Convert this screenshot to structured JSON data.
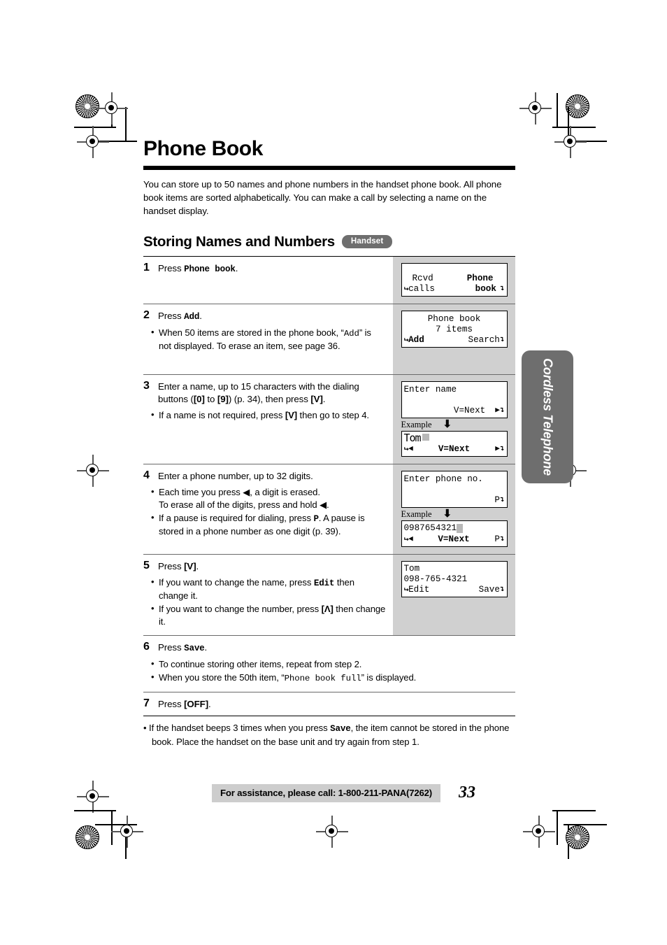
{
  "document": {
    "chapter_title": "Phone Book",
    "intro": "You can store up to 50 names and phone numbers in the handset phone book. All phone book items are sorted alphabetically. You can make a call by selecting a name on the handset display.",
    "section_title": "Storing Names and Numbers",
    "section_badge": "Handset",
    "side_tab": "Cordless Telephone",
    "page_number": "33",
    "footer_text": "For assistance, please call: 1-800-211-PANA(7262)",
    "example_label": "Example"
  },
  "steps": [
    {
      "num": "1",
      "text_pre": "Press ",
      "text_mono": "Phone book",
      "text_post": ".",
      "bullets": []
    },
    {
      "num": "2",
      "text_pre": "Press ",
      "text_mono": "Add",
      "text_post": ".",
      "bullets": [
        "When 50 items are stored in the phone book, “Add” is not displayed. To erase an item, see page 36."
      ]
    },
    {
      "num": "3",
      "text_pre": "Enter a name, up to 15 characters with the dialing buttons ([0] to [9]) (p. 34), then press [V].",
      "text_mono": "",
      "text_post": "",
      "bullets": [
        "If a name is not required, press [V] then go to step 4."
      ]
    },
    {
      "num": "4",
      "text_pre": "Enter a phone number, up to 32 digits.",
      "text_mono": "",
      "text_post": "",
      "bullets": [
        "Each time you press ◀ , a digit is erased. To erase all of the digits, press and hold ◀ .",
        "If a pause is required for dialing, press P. A pause is stored in a phone number as one digit (p. 39)."
      ]
    },
    {
      "num": "5",
      "text_pre": "Press [V].",
      "text_mono": "",
      "text_post": "",
      "bullets": [
        "If you want to change the name, press Edit then change it.",
        "If you want to change the number, press [Λ] then change it."
      ]
    },
    {
      "num": "6",
      "text_pre": "Press ",
      "text_mono": "Save",
      "text_post": ".",
      "bullets": [
        "To continue storing other items, repeat from step 2.",
        "When you store the 50th item, “Phone book full” is displayed."
      ]
    },
    {
      "num": "7",
      "text_pre": "Press [OFF].",
      "text_mono": "",
      "text_post": "",
      "bullets": []
    }
  ],
  "step_text": {
    "s1_pre": "Press",
    "s1_mono": "Phone book",
    "s1_post": ".",
    "s2_pre": "Press",
    "s2_mono": "Add",
    "s2_post": ".",
    "s2_b1_a": "When 50 items are stored in the phone book, “",
    "s2_b1_mono": "Add",
    "s2_b1_b": "” is not displayed. To erase an item, see page 36.",
    "s3_a": "Enter a name, up to 15 characters with the dialing buttons (",
    "s3_k0": "[0]",
    "s3_b": " to ",
    "s3_k9": "[9]",
    "s3_c": ") (p. 34), then press ",
    "s3_kv": "[V]",
    "s3_d": ".",
    "s3_b1_a": "If a name is not required, press ",
    "s3_b1_k": "[V]",
    "s3_b1_b": " then go to step 4.",
    "s4_a": "Enter a phone number, up to 32 digits.",
    "s4_b1_a": "Each time you press ",
    "s4_b1_b": ", a digit is erased.",
    "s4_b1_c": "To erase all of the digits, press and hold ",
    "s4_b1_d": ".",
    "s4_b2_a": "If a pause is required for dialing, press ",
    "s4_b2_mono": "P",
    "s4_b2_b": ". A pause is stored in a phone number as one digit (p. 39).",
    "s5_a": "Press ",
    "s5_k": "[V]",
    "s5_b": ".",
    "s5_b1_a": "If you want to change the name, press ",
    "s5_b1_mono": "Edit",
    "s5_b1_b": " then change it.",
    "s5_b2_a": "If you want to change the number, press ",
    "s5_b2_k": "[Λ]",
    "s5_b2_b": " then change it.",
    "s6_pre": "Press",
    "s6_mono": "Save",
    "s6_post": ".",
    "s6_b1": "To continue storing other items, repeat from step 2.",
    "s6_b2_a": "When you store the 50th item, “",
    "s6_b2_mono": "Phone book full",
    "s6_b2_b": "” is displayed.",
    "s7_a": "Press ",
    "s7_k": "[OFF]",
    "s7_b": ".",
    "tail_a": "If the handset beeps 3 times when you press ",
    "tail_mono": "Save",
    "tail_b": ", the item cannot be stored in the phone book. Place the handset on the base unit and try again from step 1."
  },
  "lcd_screens": {
    "screen1": {
      "line1_left": "Rcvd",
      "line1_right": "Phone",
      "line2_left": "calls",
      "line2_right": "book",
      "left_marker": "↵",
      "right_marker": "↴"
    },
    "screen2": {
      "line1": "Phone book",
      "line2": "7 items",
      "softkey_left": "Add",
      "softkey_right": "Search"
    },
    "screen3a": {
      "line1": "Enter name",
      "line3_center": "V=Next",
      "right_arrow": "▶"
    },
    "screen3b": {
      "name_value": "Tom",
      "softkey_center": "V=Next",
      "left_arrow": "◀",
      "right_arrow": "▶"
    },
    "screen4a": {
      "line1": "Enter phone no.",
      "pause_key": "P"
    },
    "screen4b": {
      "number_value": "0987654321",
      "softkey_center": "V=Next",
      "pause_key": "P",
      "left_arrow": "◀"
    },
    "screen5": {
      "line1": "Tom",
      "line2": "098-765-4321",
      "softkey_left": "Edit",
      "softkey_right": "Save"
    }
  }
}
